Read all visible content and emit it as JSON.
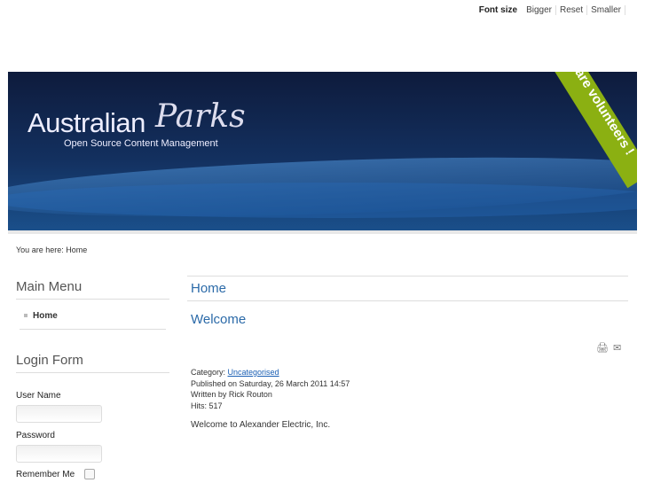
{
  "font_size": {
    "label": "Font size",
    "bigger": "Bigger",
    "reset": "Reset",
    "smaller": "Smaller"
  },
  "banner": {
    "title": "Australian",
    "title_script": "Parks",
    "subtitle": "Open Source Content Management",
    "ribbon": "We are volunteers !"
  },
  "breadcrumb": "You are here: Home",
  "main_menu": {
    "title": "Main Menu",
    "items": [
      {
        "label": "Home"
      }
    ]
  },
  "login": {
    "title": "Login Form",
    "username_label": "User Name",
    "password_label": "Password",
    "remember_label": "Remember Me"
  },
  "content": {
    "heading": "Home",
    "article_title": "Welcome",
    "category_label": "Category: ",
    "category": "Uncategorised",
    "published": "Published on Saturday, 26 March 2011 14:57",
    "author": "Written by Rick Routon",
    "hits": "Hits: 517",
    "body": "Welcome to Alexander Electric, Inc."
  },
  "icons": {
    "print": "print-icon",
    "email": "email-icon"
  }
}
